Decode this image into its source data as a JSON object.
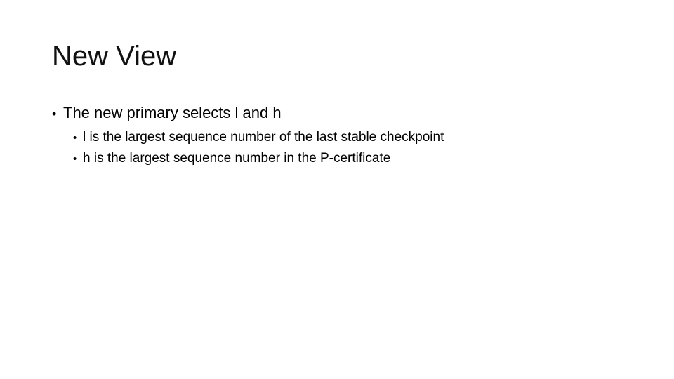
{
  "slide": {
    "title": "New View",
    "bullets": [
      {
        "text": "The new primary selects l and h",
        "children": [
          "l is the largest sequence number of the last stable checkpoint",
          "h is the largest sequence number in the P-certificate"
        ]
      }
    ],
    "bullet_glyph": "•"
  }
}
